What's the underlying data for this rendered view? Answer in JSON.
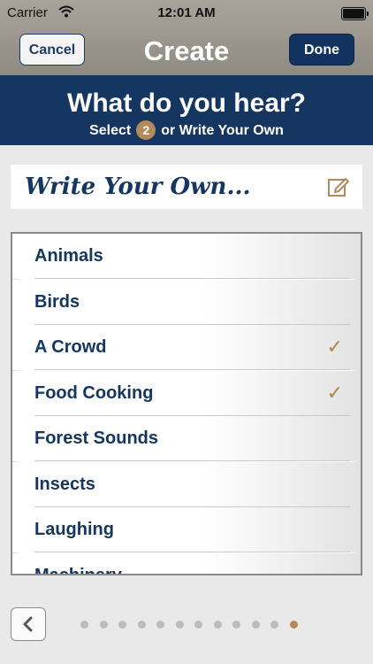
{
  "status_bar": {
    "carrier": "Carrier",
    "time": "12:01 AM"
  },
  "nav": {
    "cancel_label": "Cancel",
    "title": "Create",
    "done_label": "Done"
  },
  "banner": {
    "question": "What do you hear?",
    "select_prefix": "Select",
    "select_count": "2",
    "select_suffix": "or Write Your Own"
  },
  "write_own": {
    "label": "Write Your Own..."
  },
  "options": [
    {
      "label": "Animals",
      "checked": false
    },
    {
      "label": "Birds",
      "checked": false
    },
    {
      "label": "A Crowd",
      "checked": true
    },
    {
      "label": "Food Cooking",
      "checked": true
    },
    {
      "label": "Forest Sounds",
      "checked": false
    },
    {
      "label": "Insects",
      "checked": false
    },
    {
      "label": "Laughing",
      "checked": false
    },
    {
      "label": "Machinery",
      "checked": false
    }
  ],
  "checkmark_glyph": "✓",
  "pager": {
    "total_pages": 12,
    "current_page": 12
  },
  "colors": {
    "navy": "#143660",
    "accent": "#b58a5a",
    "nav_gray": "#9a958d"
  }
}
